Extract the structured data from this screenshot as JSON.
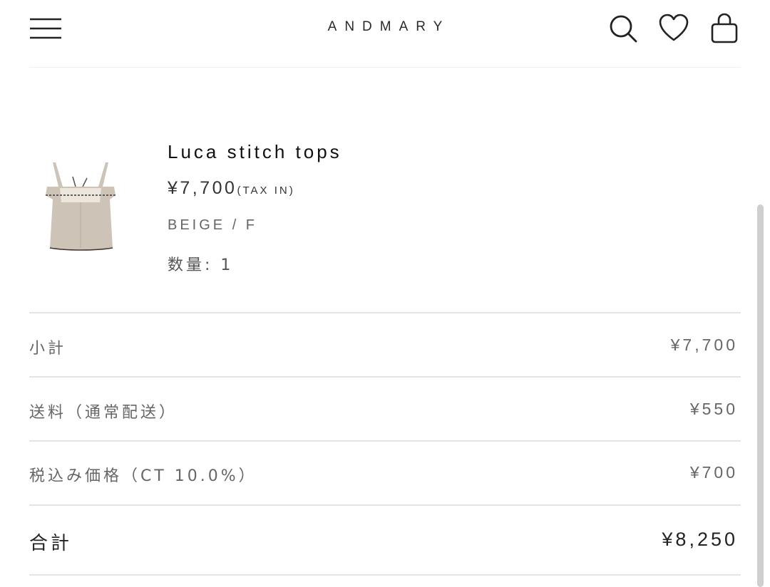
{
  "header": {
    "brand": "ANDMARY",
    "icons": [
      "menu-icon",
      "search-icon",
      "heart-icon",
      "bag-icon"
    ]
  },
  "product": {
    "name": "Luca stitch tops",
    "price": "¥7,700",
    "tax_note": "(TAX IN)",
    "variant": "BEIGE / F",
    "quantity_label": "数量: ",
    "quantity": "1"
  },
  "summary": {
    "rows": [
      {
        "label": "小計",
        "value": "¥7,700"
      },
      {
        "label": "送料（通常配送）",
        "value": "¥550"
      },
      {
        "label": "税込み価格（CT 10.0%）",
        "value": "¥700"
      }
    ],
    "total": {
      "label": "合計",
      "value": "¥8,250"
    }
  },
  "colors": {
    "text": "#222222",
    "muted": "#666666",
    "divider": "#e4e4e4",
    "product_beige": "#cdc3b6"
  }
}
